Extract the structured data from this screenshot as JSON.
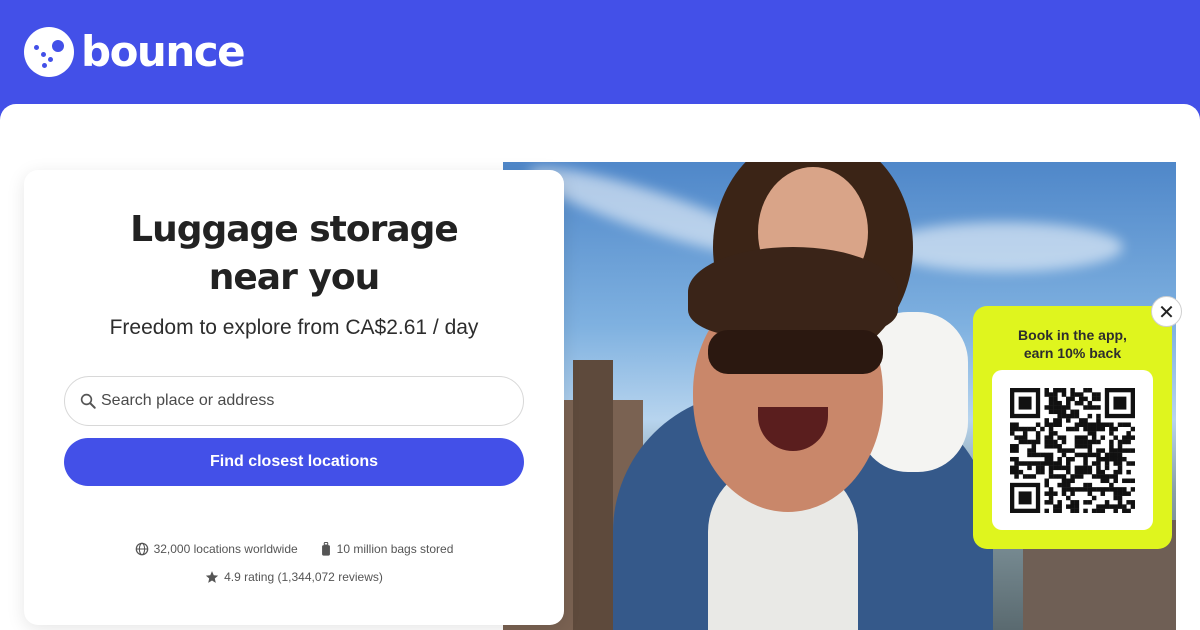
{
  "brand": {
    "name": "bounce"
  },
  "hero_card": {
    "headline_line1": "Luggage storage",
    "headline_line2": "near you",
    "subline": "Freedom to explore from CA$2.61 / day"
  },
  "search": {
    "placeholder": "Search place or address",
    "value": ""
  },
  "cta": {
    "label": "Find closest locations"
  },
  "stats": {
    "locations": "32,000 locations worldwide",
    "bags": "10 million bags stored",
    "rating": "4.9 rating (1,344,072 reviews)"
  },
  "app_promo": {
    "line1": "Book in the app,",
    "line2": "earn 10% back",
    "close_glyph": "✕"
  },
  "colors": {
    "brand": "#4350e8",
    "promo": "#dff51e",
    "text": "#222222"
  },
  "icons": [
    "search-icon",
    "globe-icon",
    "luggage-icon",
    "star-icon",
    "close-icon",
    "qr-code"
  ]
}
